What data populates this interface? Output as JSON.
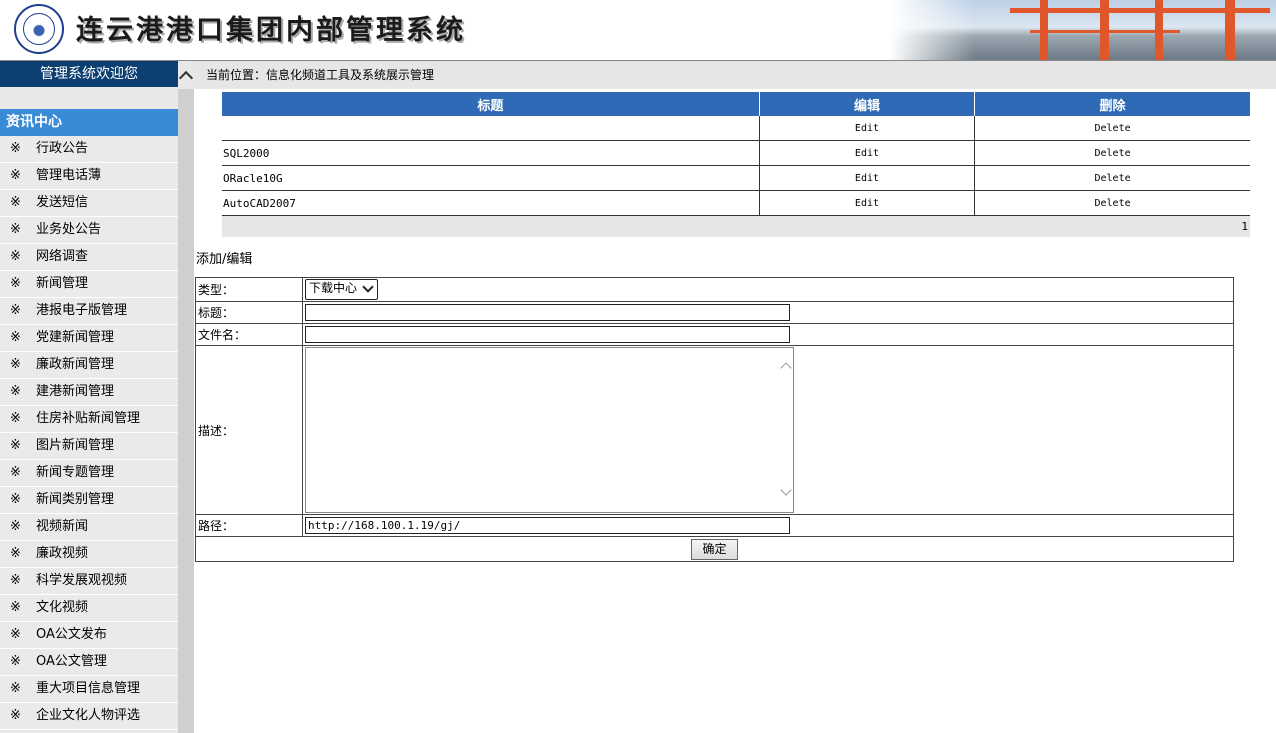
{
  "header": {
    "title": "连云港港口集团内部管理系统"
  },
  "leftnav": {
    "welcome": "管理系统欢迎您",
    "section_title": "资讯中心",
    "bullet": "※",
    "items": [
      "行政公告",
      "管理电话薄",
      "发送短信",
      "业务处公告",
      "网络调查",
      "新闻管理",
      "港报电子版管理",
      "党建新闻管理",
      "廉政新闻管理",
      "建港新闻管理",
      "住房补贴新闻管理",
      "图片新闻管理",
      "新闻专题管理",
      "新闻类别管理",
      "视频新闻",
      "廉政视频",
      "科学发展观视频",
      "文化视频",
      "OA公文发布",
      "OA公文管理",
      "重大项目信息管理",
      "企业文化人物评选"
    ]
  },
  "breadcrumb": {
    "text": "当前位置：信息化频道工具及系统展示管理"
  },
  "grid": {
    "headers": [
      "标题",
      "编辑",
      "删除"
    ],
    "rows": [
      {
        "title": "",
        "edit": "Edit",
        "delete": "Delete"
      },
      {
        "title": "SQL2000",
        "edit": "Edit",
        "delete": "Delete"
      },
      {
        "title": "ORacle10G",
        "edit": "Edit",
        "delete": "Delete"
      },
      {
        "title": "AutoCAD2007",
        "edit": "Edit",
        "delete": "Delete"
      }
    ],
    "page": "1"
  },
  "form": {
    "title": "添加/编辑",
    "type_label": "类型：",
    "type_value": "下载中心",
    "name_label": "标题：",
    "name_value": "",
    "filename_label": "文件名：",
    "filename_value": "",
    "desc_label": "描述：",
    "desc_value": "",
    "path_label": "路径：",
    "path_value": "http://168.100.1.19/gj/",
    "submit_label": "确定"
  }
}
